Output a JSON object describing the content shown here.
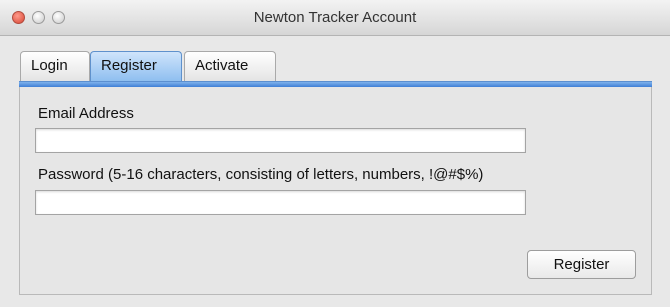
{
  "window": {
    "title": "Newton Tracker Account"
  },
  "tabs": [
    {
      "label": "Login",
      "selected": false
    },
    {
      "label": "Register",
      "selected": true
    },
    {
      "label": "Activate",
      "selected": false
    }
  ],
  "form": {
    "email_label": "Email Address",
    "email_value": "",
    "password_label": "Password (5-16 characters, consisting of letters, numbers, !@#$%)",
    "password_value": "",
    "submit_label": "Register"
  },
  "colors": {
    "selected_tab": "#8fbff0",
    "accent_bar": "#3f7fd6",
    "close_button": "#d74533"
  }
}
